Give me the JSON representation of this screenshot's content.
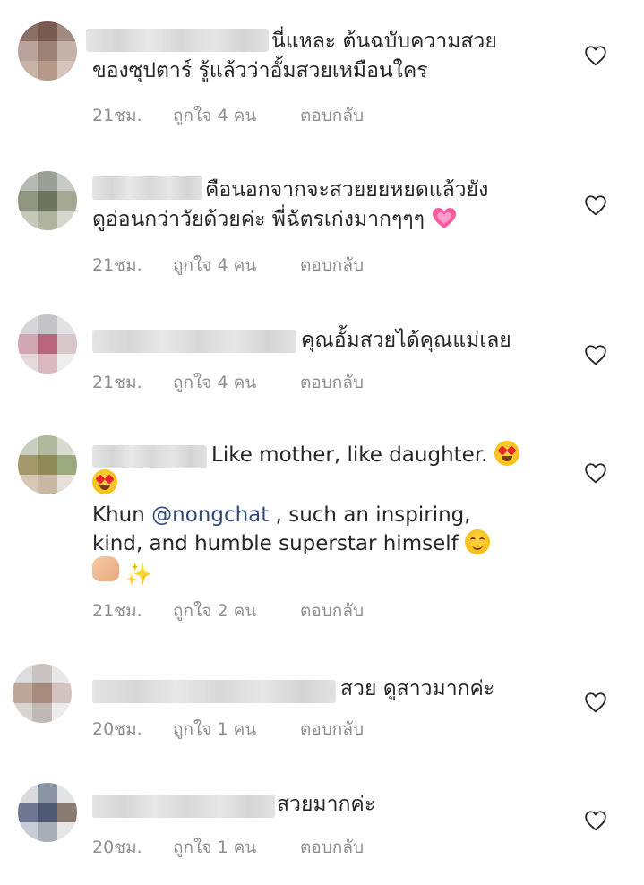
{
  "comments": [
    {
      "lines": [
        "นี่แหละ ต้นฉบับความสวย",
        "ของซุปตาร์ รู้แล้วว่าอั้มสวยเหมือนใคร"
      ],
      "time": "21ชม.",
      "likes": "ถูกใจ 4 คน",
      "reply": "ตอบกลับ"
    },
    {
      "lines": [
        "คือนอกจากจะสวยยยหยดแล้วยัง",
        "ดูอ่อนกว่าวัยด้วยค่ะ พี่ฉัตรเก่งมากๆๆๆ"
      ],
      "time": "21ชม.",
      "likes": "ถูกใจ 4 คน",
      "reply": "ตอบกลับ"
    },
    {
      "lines": [
        "คุณอั้มสวยได้คุณแม่เลย"
      ],
      "time": "21ชม.",
      "likes": "ถูกใจ 4 คน",
      "reply": "ตอบกลับ"
    },
    {
      "lines": [
        "Like mother, like daughter.",
        "Khun ",
        "@nongchat",
        " , such an inspiring,",
        "kind, and humble superstar himself"
      ],
      "time": "21ชม.",
      "likes": "ถูกใจ 2 คน",
      "reply": "ตอบกลับ"
    },
    {
      "lines": [
        "สวย ดูสาวมากค่ะ"
      ],
      "time": "20ชม.",
      "likes": "ถูกใจ 1 คน",
      "reply": "ตอบกลับ"
    },
    {
      "lines": [
        "สวยมากค่ะ"
      ],
      "time": "20ชม.",
      "likes": "ถูกใจ 1 คน",
      "reply": "ตอบกลับ"
    }
  ],
  "icons": {
    "like": "heart-outline-icon",
    "emoji_heart_eyes": "smiling-face-with-heart-eyes",
    "emoji_pink_heart": "growing-heart",
    "emoji_smile": "smiling-face",
    "emoji_clap": "clapping-hands",
    "emoji_sparkles": "sparkles"
  },
  "colors": {
    "text": "#262626",
    "meta": "#8e8e8e",
    "mention": "#2f4a7a",
    "heart_outline": "#262626"
  }
}
